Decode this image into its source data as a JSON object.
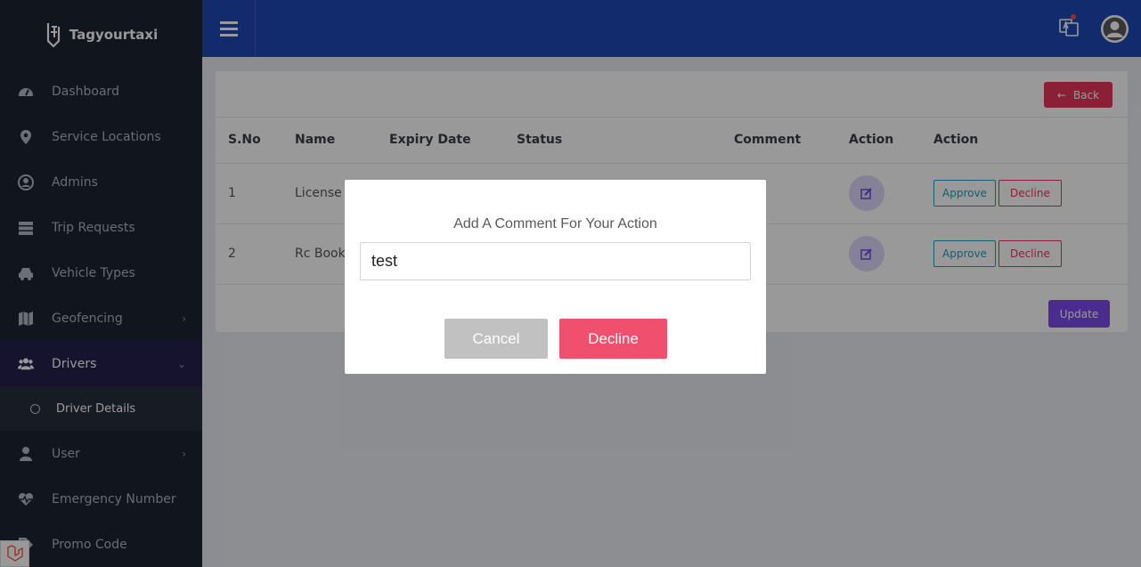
{
  "brand": {
    "name": "Tagyourtaxi"
  },
  "sidebar": {
    "items": [
      {
        "label": "Dashboard",
        "icon": "dashboard-icon"
      },
      {
        "label": "Service Locations",
        "icon": "map-pin-icon"
      },
      {
        "label": "Admins",
        "icon": "user-circle-icon"
      },
      {
        "label": "Trip Requests",
        "icon": "server-icon"
      },
      {
        "label": "Vehicle Types",
        "icon": "taxi-icon"
      },
      {
        "label": "Geofencing",
        "icon": "map-icon",
        "chevron": "›"
      },
      {
        "label": "Drivers",
        "icon": "users-icon",
        "chevron": "⌄"
      },
      {
        "label": "User",
        "icon": "user-icon",
        "chevron": "›"
      },
      {
        "label": "Emergency Number",
        "icon": "heartbeat-icon"
      },
      {
        "label": "Promo Code",
        "icon": "tag-icon"
      }
    ],
    "sub_item": "Driver Details"
  },
  "page": {
    "back_label": "Back",
    "back_arrow": "←",
    "update_label": "Update",
    "table": {
      "headers": [
        "S.No",
        "Name",
        "Expiry Date",
        "Status",
        "Comment",
        "Action",
        "Action"
      ],
      "rows": [
        {
          "sno": "1",
          "name": "License"
        },
        {
          "sno": "2",
          "name": "Rc Book"
        }
      ],
      "approve_label": "Approve",
      "decline_label": "Decline"
    }
  },
  "modal": {
    "title": "Add A Comment For Your Action",
    "input_value": "test",
    "cancel_label": "Cancel",
    "decline_label": "Decline"
  },
  "colors": {
    "header": "#1f49b6",
    "sidebar": "#1c2433",
    "accent_red": "#e8355a",
    "accent_purple": "#7a4ae8",
    "accent_teal": "#18a3c0"
  }
}
